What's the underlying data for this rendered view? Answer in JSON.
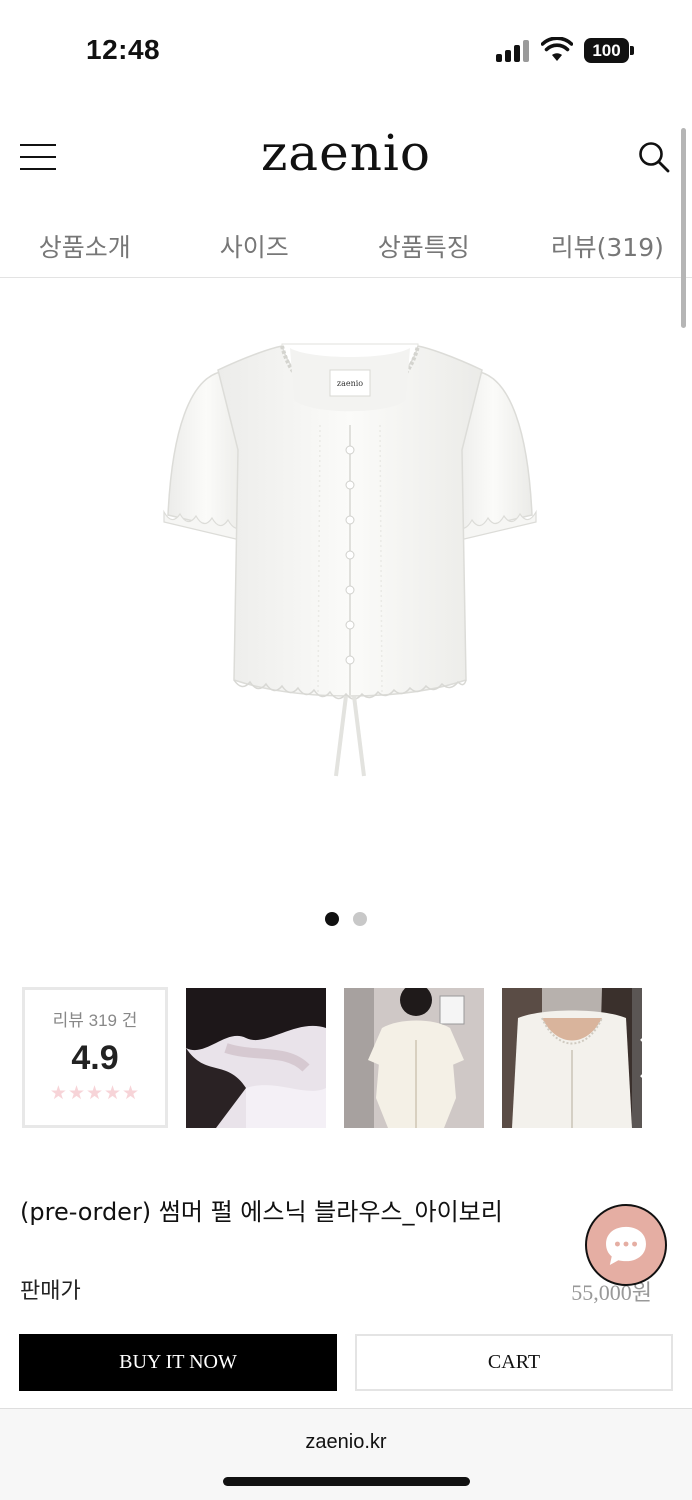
{
  "status_bar": {
    "time": "12:48",
    "battery": "100"
  },
  "header": {
    "logo": "zaenio"
  },
  "tabs": [
    {
      "label": "상품소개"
    },
    {
      "label": "사이즈"
    },
    {
      "label": "상품특징"
    },
    {
      "label": "리뷰(319)"
    }
  ],
  "product_image": {
    "label_text": "zaenio"
  },
  "carousel": {
    "current": 1,
    "total": 2,
    "active_color": "#111111",
    "inactive_color": "#c8c8c8"
  },
  "reviews": {
    "count_label": "리뷰 319 건",
    "score": "4.9",
    "stars": "★★★★★"
  },
  "product": {
    "title": "(pre-order) 썸머 펄 에스닉 블라우스_아이보리",
    "price_label": "판매가",
    "price": "55,000원"
  },
  "actions": {
    "buy_label": "BUY IT NOW",
    "cart_label": "CART"
  },
  "browser": {
    "url": "zaenio.kr"
  },
  "colors": {
    "chat_button": "#e5aea3",
    "buy_button": "#000000",
    "stars": "#f7d4d8"
  }
}
